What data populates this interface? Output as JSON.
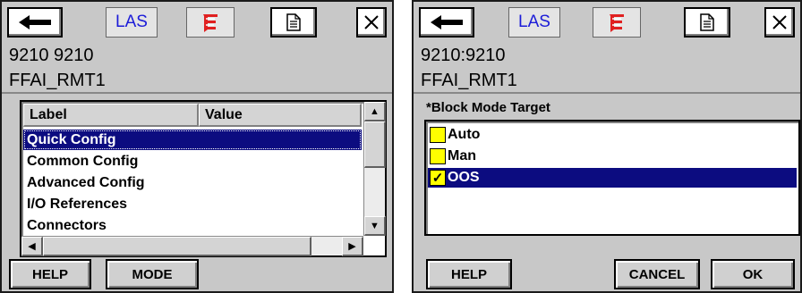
{
  "left": {
    "toolbar": {
      "back_icon": "left-arrow",
      "las_label": "LAS",
      "ff_icon": "fieldbus-logo",
      "doc_icon": "document",
      "close_icon": "close"
    },
    "device_line1": "9210 9210",
    "device_line2": "FFAI_RMT1",
    "list": {
      "headers": [
        "Label",
        "Value"
      ],
      "rows": [
        "Quick Config",
        "Common Config",
        "Advanced Config",
        "I/O References",
        "Connectors"
      ],
      "selected_index": 0
    },
    "buttons": {
      "help": "HELP",
      "mode": "MODE"
    }
  },
  "right": {
    "toolbar": {
      "back_icon": "left-arrow",
      "las_label": "LAS",
      "ff_icon": "fieldbus-logo",
      "doc_icon": "document",
      "close_icon": "close"
    },
    "device_line1": "9210:9210",
    "device_line2": "FFAI_RMT1",
    "field_label": "*Block Mode Target",
    "options": [
      {
        "label": "Auto",
        "checked": false
      },
      {
        "label": "Man",
        "checked": false
      },
      {
        "label": "OOS",
        "checked": true
      }
    ],
    "selected_index": 2,
    "buttons": {
      "help": "HELP",
      "cancel": "CANCEL",
      "ok": "OK"
    }
  },
  "colors": {
    "selection": "#0c0c80",
    "las_text": "#1c1cd8",
    "checkbox": "#ffff00",
    "panel_bg": "#c8c8c8"
  }
}
